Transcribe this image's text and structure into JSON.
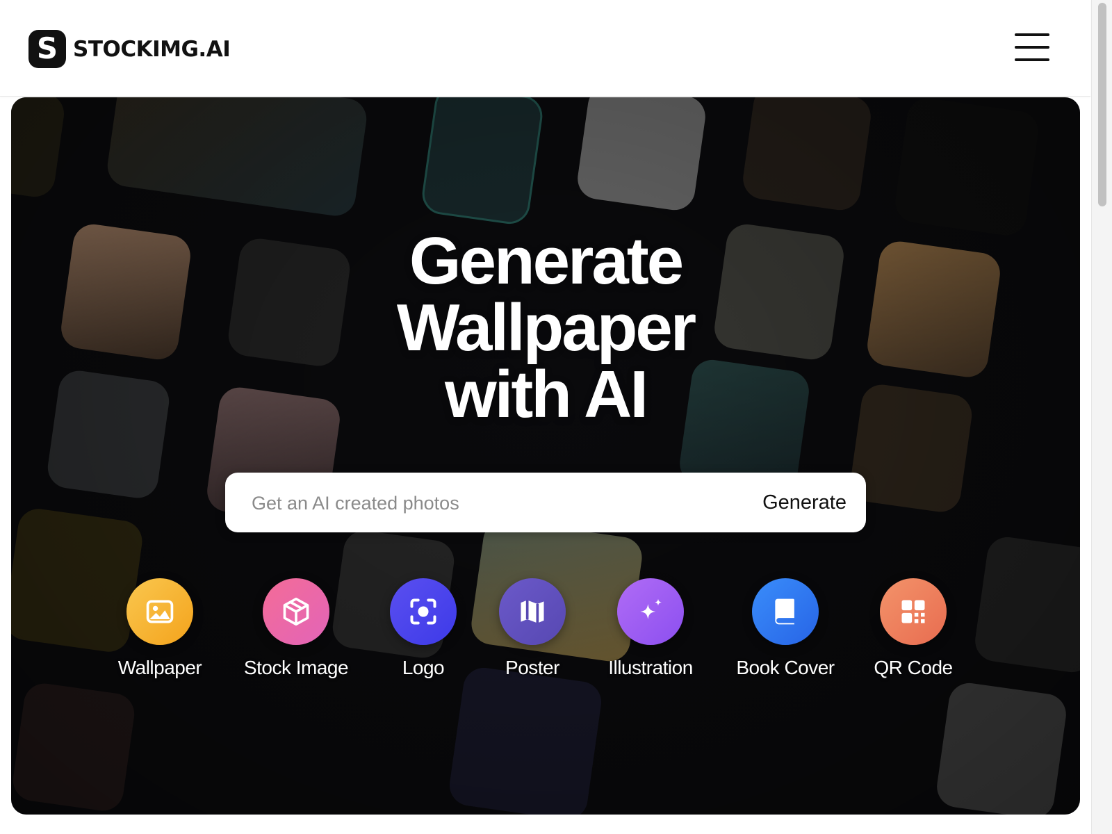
{
  "brand": {
    "logo_letter": "S",
    "name": "STOCKIMG.AI"
  },
  "header": {
    "menu_icon": "hamburger-menu-icon"
  },
  "hero": {
    "title_lines": [
      "Generate",
      "Wallpaper",
      "with AI"
    ]
  },
  "search": {
    "placeholder": "Get an AI created photos",
    "value": "",
    "button_label": "Generate"
  },
  "categories": [
    {
      "label": "Wallpaper",
      "icon": "image-icon",
      "color_from": "#f9c74f",
      "color_to": "#f4a31c"
    },
    {
      "label": "Stock Image",
      "icon": "box-icon",
      "color_from": "#f46c97",
      "color_to": "#e264b8"
    },
    {
      "label": "Logo",
      "icon": "scan-target-icon",
      "color_from": "#5a4ff0",
      "color_to": "#3d3ae8"
    },
    {
      "label": "Poster",
      "icon": "map-icon",
      "color_from": "#6b59c9",
      "color_to": "#5748b2"
    },
    {
      "label": "Illustration",
      "icon": "sparkle-icon",
      "color_from": "#b06cf5",
      "color_to": "#8c4ff0"
    },
    {
      "label": "Book Cover",
      "icon": "book-icon",
      "color_from": "#3a8dfa",
      "color_to": "#2764e6"
    },
    {
      "label": "QR Code",
      "icon": "qr-code-icon",
      "color_from": "#f3936a",
      "color_to": "#e86c50"
    }
  ]
}
